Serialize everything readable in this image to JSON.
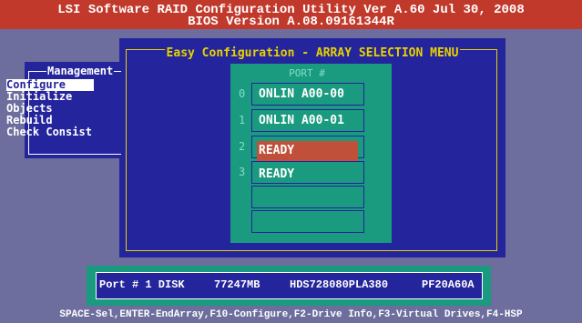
{
  "header": {
    "title": "LSI Software RAID Configuration Utility Ver A.60 Jul 30, 2008",
    "bios_version": "BIOS Version   A.08.09161344R"
  },
  "management": {
    "title": "Management",
    "items": [
      {
        "label": "Configure",
        "selected": true
      },
      {
        "label": "Initialize",
        "selected": false
      },
      {
        "label": "Objects",
        "selected": false
      },
      {
        "label": "Rebuild",
        "selected": false
      },
      {
        "label": "Check Consist",
        "selected": false
      }
    ]
  },
  "dialog": {
    "title": "Easy Configuration - ARRAY SELECTION MENU"
  },
  "port_list": {
    "header": "PORT #",
    "ports": [
      {
        "number": "0",
        "status": "ONLIN A00-00"
      },
      {
        "number": "1",
        "status": "ONLIN A00-01"
      },
      {
        "number": "2",
        "status": "READY",
        "highlighted": true
      },
      {
        "number": "3",
        "status": "READY"
      }
    ]
  },
  "disk_info": {
    "port": "Port # 1 DISK",
    "size": "77247MB",
    "model": "HDS728080PLA380",
    "firmware": "PF20A60A"
  },
  "statusbar": {
    "text": "SPACE-Sel,ENTER-EndArray,F10-Configure,F2-Drive Info,F3-Virtual Drives,F4-HSP"
  },
  "colors": {
    "background": "#6e6e9e",
    "title_bar": "#c0392b",
    "panel": "#24249c",
    "accent_yellow": "#e8d200",
    "teal": "#1a9a7e",
    "highlight": "#c0503a"
  }
}
